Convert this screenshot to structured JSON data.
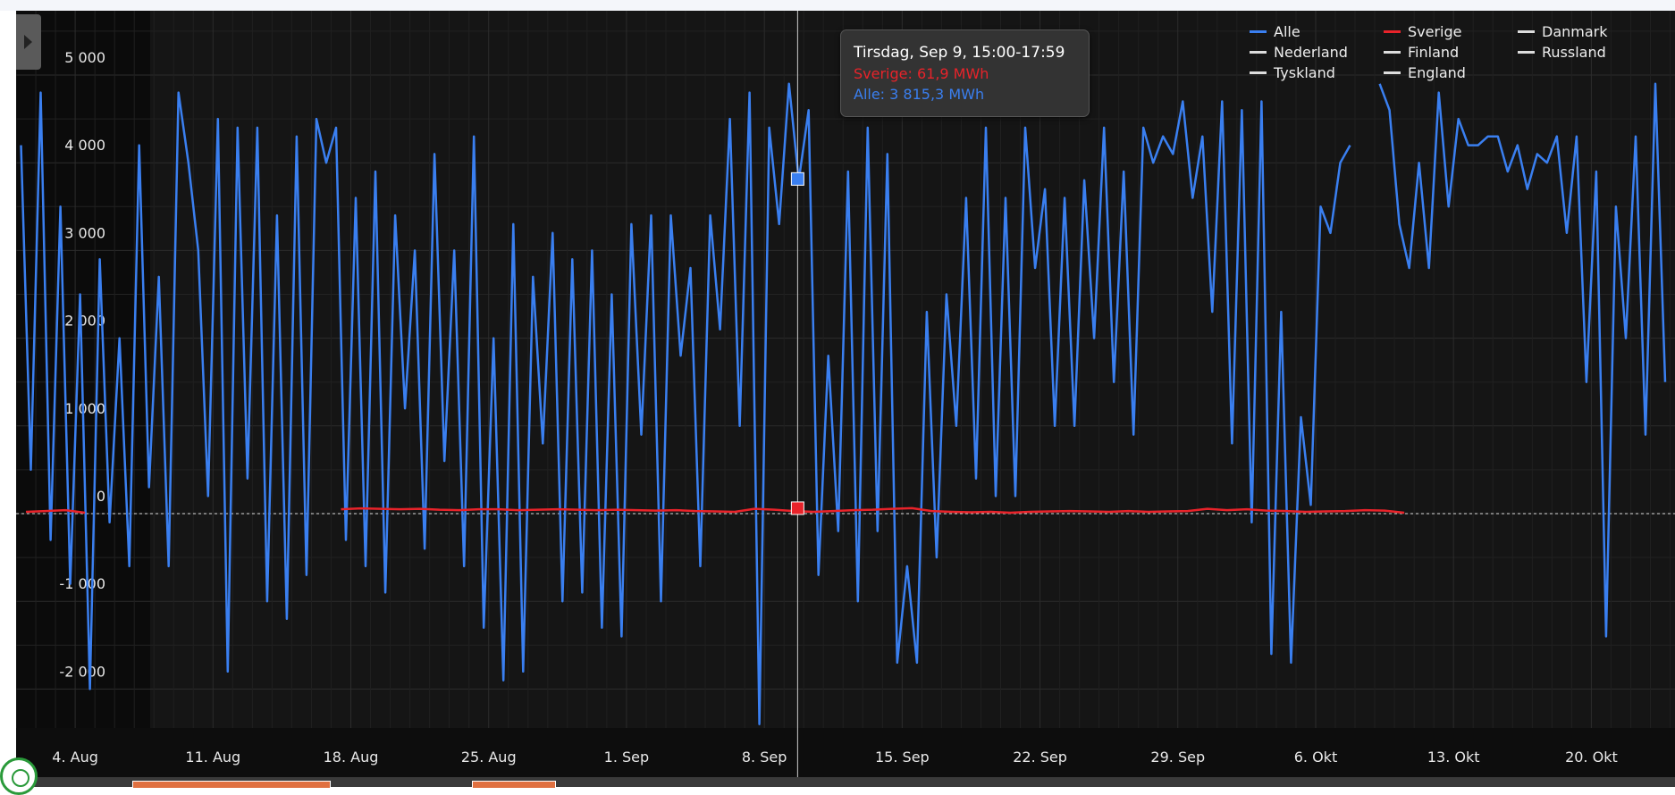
{
  "chart_data": {
    "type": "line",
    "start_date": "2025-08-01",
    "alle_interval_hours": 12,
    "sverige_interval_hours": 24,
    "ylim": [
      -2500,
      5400
    ],
    "yticks": [
      5000,
      4000,
      3000,
      2000,
      1000,
      0,
      -1000,
      -2000
    ],
    "ytick_labels": [
      "5 000",
      "4 000",
      "3 000",
      "2 000",
      "1 000",
      "0",
      "-1 000",
      "-2 000"
    ],
    "xticks": [
      {
        "day": 3,
        "label": "4. Aug"
      },
      {
        "day": 10,
        "label": "11. Aug"
      },
      {
        "day": 17,
        "label": "18. Aug"
      },
      {
        "day": 24,
        "label": "25. Aug"
      },
      {
        "day": 31,
        "label": "1. Sep"
      },
      {
        "day": 38,
        "label": "8. Sep"
      },
      {
        "day": 45,
        "label": "15. Sep"
      },
      {
        "day": 52,
        "label": "22. Sep"
      },
      {
        "day": 59,
        "label": "29. Sep"
      },
      {
        "day": 66,
        "label": "6. Okt"
      },
      {
        "day": 73,
        "label": "13. Okt"
      },
      {
        "day": 80,
        "label": "20. Okt"
      }
    ],
    "unit": "MWh",
    "grid": true,
    "legend_position": "top-right",
    "series": [
      {
        "name": "Alle",
        "color": "#3a7ff0",
        "values": [
          4200,
          500,
          4800,
          -300,
          3500,
          -800,
          2500,
          -2000,
          2900,
          -100,
          2000,
          -600,
          4200,
          300,
          2700,
          -600,
          4800,
          4000,
          3000,
          200,
          4500,
          -1800,
          4400,
          400,
          4400,
          -1000,
          3400,
          -1200,
          4300,
          -700,
          4500,
          4000,
          4400,
          -300,
          3600,
          -600,
          3900,
          -900,
          3400,
          1200,
          3000,
          -400,
          4100,
          600,
          3000,
          -600,
          4300,
          -1300,
          2000,
          -1900,
          3300,
          -1800,
          2700,
          800,
          3200,
          -1000,
          2900,
          -900,
          3000,
          -1300,
          2500,
          -1400,
          3300,
          900,
          3400,
          -1000,
          3400,
          1800,
          2800,
          -600,
          3400,
          2100,
          4500,
          1000,
          4800,
          -2400,
          4400,
          3300,
          4900,
          3800,
          4600,
          -700,
          1800,
          -200,
          3900,
          -1000,
          4400,
          -200,
          4100,
          -1700,
          -600,
          -1700,
          2300,
          -500,
          2500,
          1000,
          3600,
          400,
          4400,
          200,
          3600,
          200,
          4400,
          2800,
          3700,
          1000,
          3600,
          1000,
          3800,
          2000,
          4400,
          1500,
          3900,
          900,
          4400,
          4000,
          4300,
          4100,
          4700,
          3600,
          4300,
          2300,
          4700,
          800,
          4600,
          -100,
          4700,
          -1600,
          2300,
          -1700,
          1100,
          100,
          3500,
          3200,
          4000,
          4200,
          null,
          null,
          4900,
          4600,
          3300,
          2800,
          4000,
          2800,
          4800,
          3500,
          4500,
          4200,
          4200,
          4300,
          4300,
          3900,
          4200,
          3700,
          4100,
          4000,
          4300,
          3200,
          4300,
          1500,
          3900,
          -1400,
          3500,
          2000,
          4300,
          900,
          4900,
          1500
        ]
      },
      {
        "name": "Sverige",
        "color": "#e8232a",
        "values": [
          20,
          30,
          40,
          10,
          null,
          null,
          null,
          null,
          null,
          null,
          null,
          null,
          null,
          null,
          null,
          null,
          50,
          60,
          55,
          50,
          55,
          45,
          40,
          50,
          50,
          40,
          45,
          50,
          45,
          40,
          45,
          40,
          35,
          40,
          30,
          25,
          20,
          55,
          45,
          30,
          20,
          30,
          40,
          45,
          55,
          62,
          30,
          20,
          15,
          20,
          10,
          20,
          25,
          30,
          25,
          20,
          30,
          20,
          25,
          30,
          55,
          40,
          50,
          35,
          30,
          20,
          25,
          30,
          40,
          35,
          10
        ]
      },
      {
        "name": "Danmark",
        "color": "#dddddd",
        "values": []
      },
      {
        "name": "Nederland",
        "color": "#dddddd",
        "values": []
      },
      {
        "name": "Finland",
        "color": "#dddddd",
        "values": []
      },
      {
        "name": "Russland",
        "color": "#dddddd",
        "values": []
      },
      {
        "name": "Tyskland",
        "color": "#dddddd",
        "values": []
      },
      {
        "name": "England",
        "color": "#dddddd",
        "values": []
      }
    ],
    "crosshair_day": 39.69
  },
  "tooltip": {
    "title": "Tirsdag, Sep 9, 15:00-17:59",
    "sverige": "Sverige: 61,9 MWh",
    "alle": "Alle: 3 815,3 MWh",
    "sverige_value": 61.9,
    "alle_value": 3815.3
  },
  "legend": [
    {
      "label": "Alle",
      "color": "#3a7ff0"
    },
    {
      "label": "Sverige",
      "color": "#e8232a"
    },
    {
      "label": "Danmark",
      "color": "#dddddd"
    },
    {
      "label": "Nederland",
      "color": "#dddddd"
    },
    {
      "label": "Finland",
      "color": "#dddddd"
    },
    {
      "label": "Russland",
      "color": "#dddddd"
    },
    {
      "label": "Tyskland",
      "color": "#dddddd"
    },
    {
      "label": "England",
      "color": "#dddddd"
    }
  ]
}
